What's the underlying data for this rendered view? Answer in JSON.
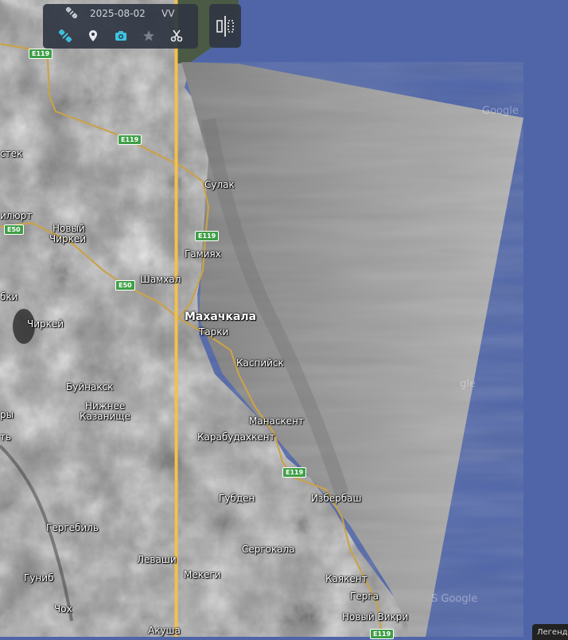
{
  "toolbar": {
    "date": "2025-08-02",
    "polarization": "VV",
    "icons": [
      "satellite-icon",
      "satellite-icon",
      "map-pin-icon",
      "camera-icon",
      "star-icon",
      "scissors-icon",
      "compare-icon"
    ]
  },
  "legend": {
    "label": "Легенда"
  },
  "map": {
    "cities": [
      {
        "name": "стек"
      },
      {
        "name": "Сулак"
      },
      {
        "name": "илюрт"
      },
      {
        "name": "Новый"
      },
      {
        "name": "Чиркей"
      },
      {
        "name": "Гамиях"
      },
      {
        "name": "Шамхал"
      },
      {
        "name": "бки"
      },
      {
        "name": "Махачкала"
      },
      {
        "name": "Чиркей"
      },
      {
        "name": "Тарки"
      },
      {
        "name": "Каспийск"
      },
      {
        "name": "Буйнакск"
      },
      {
        "name": "Нижнее"
      },
      {
        "name": "Казанище"
      },
      {
        "name": "ры"
      },
      {
        "name": "ть"
      },
      {
        "name": "Манаскент"
      },
      {
        "name": "Карабудахкент"
      },
      {
        "name": "Губден"
      },
      {
        "name": "Избербаш"
      },
      {
        "name": "Гергебиль"
      },
      {
        "name": "Сергокала"
      },
      {
        "name": "Леваши"
      },
      {
        "name": "Гуниб"
      },
      {
        "name": "Мекеги"
      },
      {
        "name": "Каякент"
      },
      {
        "name": "Герга"
      },
      {
        "name": "Чох"
      },
      {
        "name": "Новый Викри"
      },
      {
        "name": "Акуша"
      }
    ],
    "roads": [
      "E119",
      "E119",
      "E50",
      "E50",
      "E119",
      "E119",
      "E119"
    ],
    "watermarks": [
      "Google",
      "gle",
      "S Google"
    ]
  },
  "colors": {
    "sea": "#4f65a8",
    "swipe_line": "#f5c04a",
    "active_icon": "#3ec4e0",
    "toolbar_bg": "#303642"
  }
}
